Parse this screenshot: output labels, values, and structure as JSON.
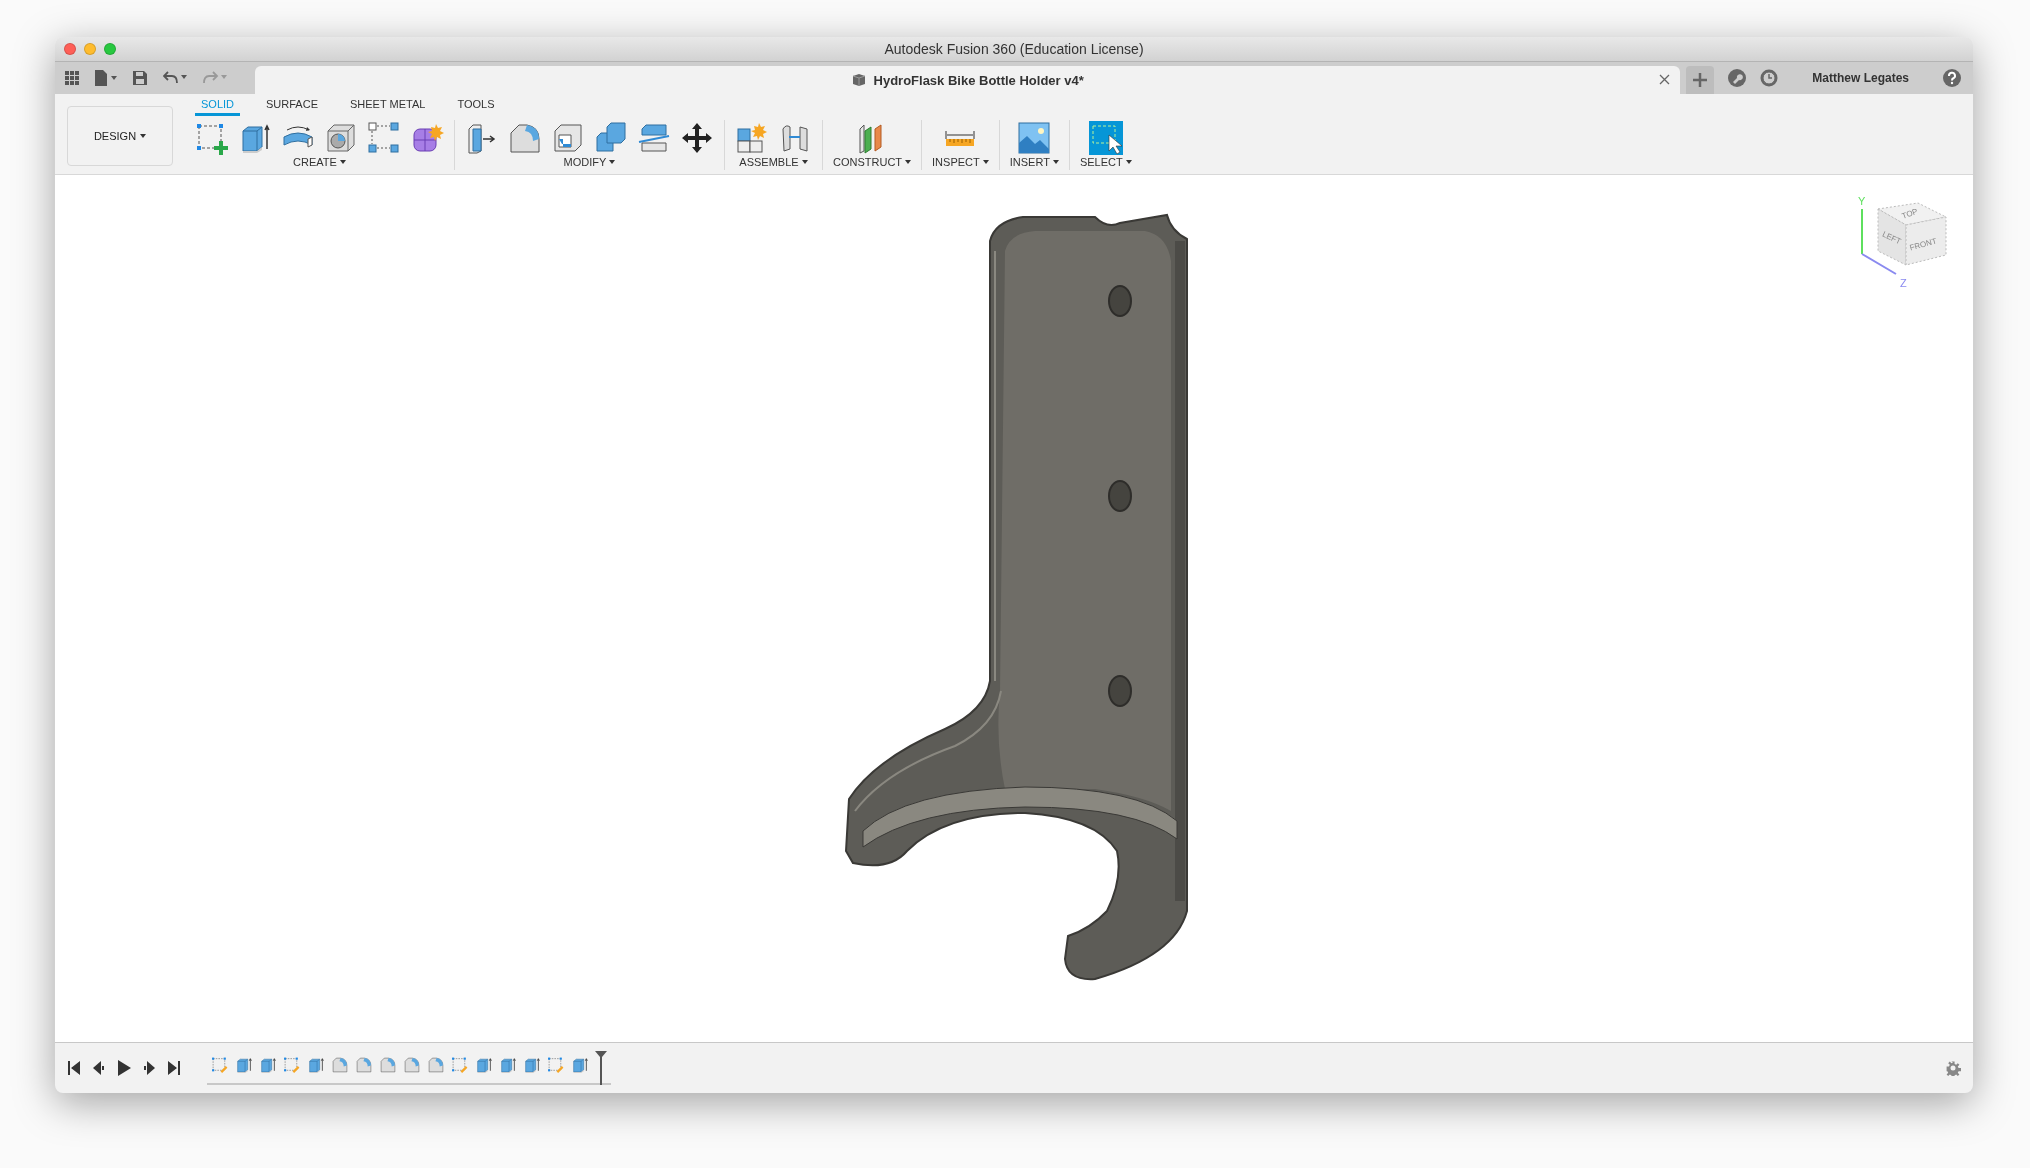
{
  "window": {
    "title": "Autodesk Fusion 360 (Education License)"
  },
  "document_tab": {
    "title": "HydroFlask Bike Bottle Holder v4*"
  },
  "user": {
    "name": "Matthew Legates"
  },
  "workspace": {
    "label": "DESIGN"
  },
  "toolbar_tabs": [
    {
      "label": "SOLID",
      "selected": true
    },
    {
      "label": "SURFACE",
      "selected": false
    },
    {
      "label": "SHEET METAL",
      "selected": false
    },
    {
      "label": "TOOLS",
      "selected": false
    }
  ],
  "tool_groups": [
    {
      "label": "CREATE",
      "tools": [
        {
          "kind": "sketch"
        },
        {
          "kind": "extrude"
        },
        {
          "kind": "revolve"
        },
        {
          "kind": "hole"
        },
        {
          "kind": "pattern"
        },
        {
          "kind": "form"
        }
      ]
    },
    {
      "label": "MODIFY",
      "tools": [
        {
          "kind": "presspull"
        },
        {
          "kind": "fillet"
        },
        {
          "kind": "shell"
        },
        {
          "kind": "combine"
        },
        {
          "kind": "split"
        },
        {
          "kind": "move"
        }
      ]
    },
    {
      "label": "ASSEMBLE",
      "tools": [
        {
          "kind": "component"
        },
        {
          "kind": "joint"
        }
      ]
    },
    {
      "label": "CONSTRUCT",
      "tools": [
        {
          "kind": "plane"
        }
      ]
    },
    {
      "label": "INSPECT",
      "tools": [
        {
          "kind": "measure"
        }
      ]
    },
    {
      "label": "INSERT",
      "tools": [
        {
          "kind": "image"
        }
      ]
    },
    {
      "label": "SELECT",
      "tools": [
        {
          "kind": "select"
        }
      ]
    }
  ],
  "viewcube": {
    "top": "TOP",
    "left": "LEFT",
    "front": "FRONT",
    "y_axis": "Y",
    "z_axis": "Z"
  },
  "timeline": [
    {
      "kind": "sketch"
    },
    {
      "kind": "extrude"
    },
    {
      "kind": "extrude"
    },
    {
      "kind": "sketch"
    },
    {
      "kind": "extrude"
    },
    {
      "kind": "fillet"
    },
    {
      "kind": "fillet"
    },
    {
      "kind": "fillet"
    },
    {
      "kind": "fillet"
    },
    {
      "kind": "fillet"
    },
    {
      "kind": "sketch"
    },
    {
      "kind": "extrude"
    },
    {
      "kind": "extrude"
    },
    {
      "kind": "extrude"
    },
    {
      "kind": "sketch"
    },
    {
      "kind": "extrude"
    }
  ]
}
